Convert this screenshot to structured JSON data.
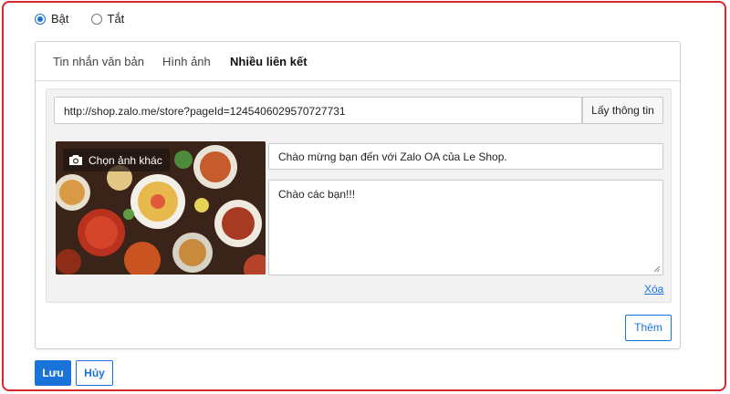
{
  "status_options": [
    {
      "label": "Bật",
      "selected": true
    },
    {
      "label": "Tắt",
      "selected": false
    }
  ],
  "tabs": [
    {
      "label": "Tin nhắn văn bản",
      "active": false
    },
    {
      "label": "Hình ảnh",
      "active": false
    },
    {
      "label": "Nhiều liên kết",
      "active": true
    }
  ],
  "link_form": {
    "url_value": "http://shop.zalo.me/store?pageId=1245406029570727731",
    "fetch_label": "Lấy thông tin",
    "change_photo_label": "Chọn ảnh khác",
    "title_value": "Chào mừng bạn đến với Zalo OA của Le Shop.",
    "description_value": "Chào các bạn!!!",
    "delete_label": "Xóa"
  },
  "add_label": "Thêm",
  "footer": {
    "save_label": "Lưu",
    "cancel_label": "Hủy"
  },
  "colors": {
    "accent": "#1a73d9",
    "frame_border": "#d8262d"
  }
}
